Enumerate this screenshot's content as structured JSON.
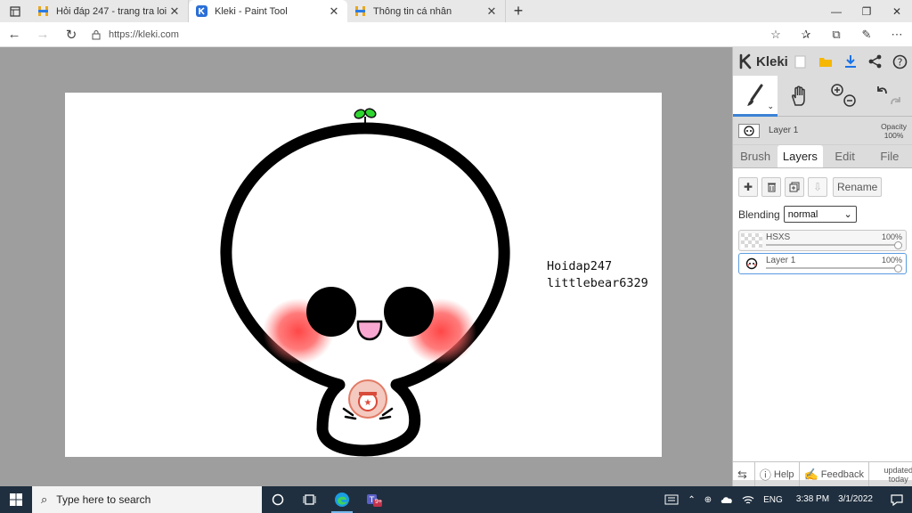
{
  "browser": {
    "tabs": [
      {
        "title": "Hỏi đáp 247 - trang tra loi",
        "active": false
      },
      {
        "title": "Kleki - Paint Tool",
        "active": true
      },
      {
        "title": "Thông tin cá nhân",
        "active": false
      }
    ],
    "new_tab": "+",
    "url": "https://kleki.com"
  },
  "canvas": {
    "text_line1": "Hoidap247",
    "text_line2": "littlebear6329"
  },
  "kleki": {
    "logo": "Kleki",
    "current_layer": "Layer 1",
    "opacity_label": "Opacity",
    "opacity_value": "100%",
    "tabs": [
      "Brush",
      "Layers",
      "Edit",
      "File"
    ],
    "active_tab": "Layers",
    "rename_label": "Rename",
    "blending_label": "Blending",
    "blending_value": "normal",
    "layers": [
      {
        "name": "HSXS",
        "opacity": "100%",
        "opacity_fraction": 1.0
      },
      {
        "name": "Layer 1",
        "opacity": "100%",
        "opacity_fraction": 1.0,
        "selected": true
      }
    ],
    "bottom": {
      "help": "Help",
      "feedback": "Feedback",
      "updated_line1": "updated",
      "updated_line2": "today"
    }
  },
  "taskbar": {
    "search_placeholder": "Type here to search",
    "language": "ENG",
    "time": "3:38 PM",
    "date": "3/1/2022",
    "teams_badge": "9+"
  },
  "colors": {
    "tab_active": "#ffffff",
    "workspace": "#9e9e9e",
    "panel": "#dcdcdc",
    "accent": "#3b82d6",
    "taskbar": "#1f2f3f",
    "blush": "#ff4b4b",
    "sprout": "#2fd62f"
  }
}
